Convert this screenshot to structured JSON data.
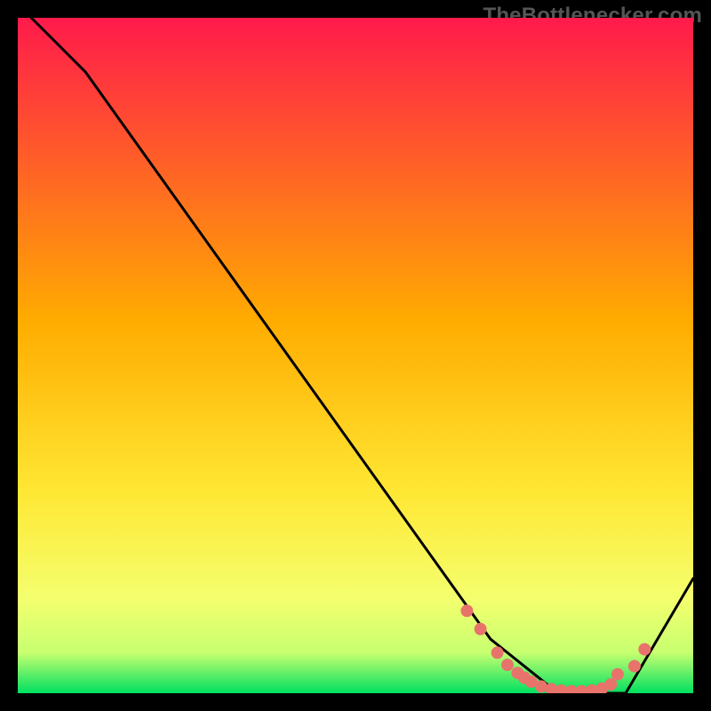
{
  "watermark": "TheBottlenecker.com",
  "chart_data": {
    "type": "line",
    "title": "",
    "xlabel": "",
    "ylabel": "",
    "xlim": [
      0,
      100
    ],
    "ylim": [
      0,
      100
    ],
    "background_gradient": [
      "#ff1a4b",
      "#ffc400",
      "#f7ff57",
      "#00e060"
    ],
    "series": [
      {
        "name": "bottleneck-curve",
        "color": "#000000",
        "x": [
          2,
          10,
          70,
          80,
          90,
          100
        ],
        "y": [
          100,
          92,
          8,
          0,
          0,
          17
        ]
      }
    ],
    "markers": {
      "name": "highlight-dots",
      "color": "#e8736b",
      "x": [
        66.5,
        68.5,
        71,
        72.5,
        74,
        75,
        76,
        77.5,
        79,
        80.5,
        82,
        83.5,
        85,
        86.5,
        87.8,
        88.8,
        91.3,
        92.8
      ],
      "y": [
        12.2,
        9.5,
        6.0,
        4.2,
        3.0,
        2.3,
        1.7,
        1.0,
        0.6,
        0.4,
        0.3,
        0.3,
        0.4,
        0.7,
        1.3,
        2.8,
        4.0,
        6.5
      ]
    }
  }
}
